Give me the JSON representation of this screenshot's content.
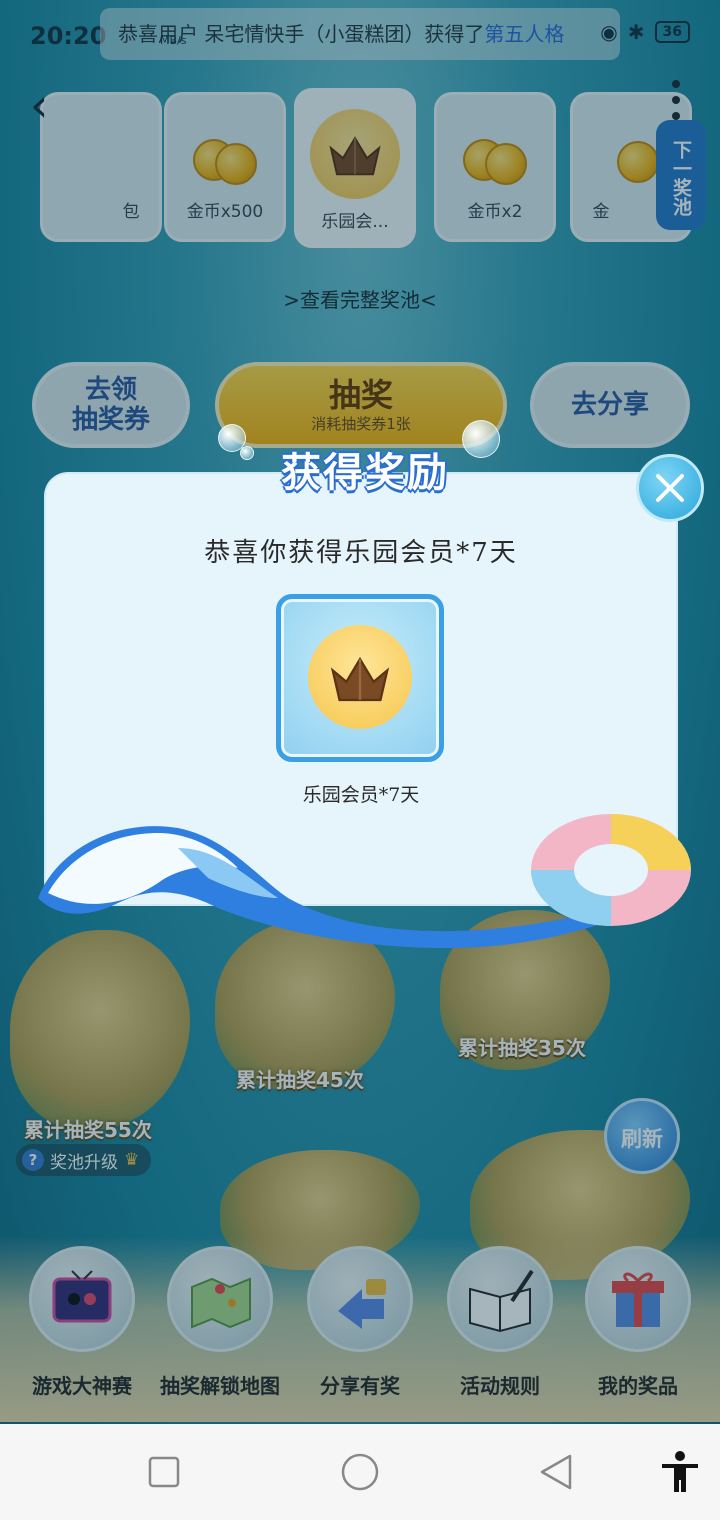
{
  "status": {
    "time": "20:20",
    "net_speed": "MB/s",
    "ticker_prefix": "恭喜用户 呆宅情快手（小蛋糕团）获得了",
    "ticker_highlight": "第五人格",
    "battery": "36"
  },
  "header": {
    "next_pool": "下一奖池"
  },
  "prize_pool": [
    {
      "label": "包",
      "icon": "gift-icon"
    },
    {
      "label": "金币x500",
      "icon": "coin-icon"
    },
    {
      "label": "乐园会...",
      "icon": "crown-icon",
      "active": true
    },
    {
      "label": "金币x2",
      "icon": "coin-icon"
    },
    {
      "label": "金",
      "icon": "coin-icon"
    }
  ],
  "view_pool": ">查看完整奖池<",
  "actions": {
    "get_ticket": "去领\n抽奖券",
    "get_ticket_line1": "去领",
    "get_ticket_line2": "抽奖券",
    "draw": "抽奖",
    "draw_sub": "消耗抽奖券1张",
    "share": "去分享"
  },
  "map": {
    "milestone_55": "累计抽奖55次",
    "milestone_45": "累计抽奖45次",
    "milestone_35": "累计抽奖35次",
    "upgrade": "奖池升级",
    "refresh": "刷新"
  },
  "dock": [
    {
      "label": "游戏大神赛",
      "icon": "tv-icon"
    },
    {
      "label": "抽奖解锁地图",
      "icon": "map-icon"
    },
    {
      "label": "分享有奖",
      "icon": "share-icon"
    },
    {
      "label": "活动规则",
      "icon": "book-icon"
    },
    {
      "label": "我的奖品",
      "icon": "gift-box-icon"
    }
  ],
  "modal": {
    "title": "获得奖励",
    "message": "恭喜你获得乐园会员*7天",
    "reward_name": "乐园会员*7天"
  },
  "colors": {
    "accent_blue": "#2a6fd0",
    "draw_button": "#f8b510",
    "modal_bg": "#e6f5fb"
  }
}
